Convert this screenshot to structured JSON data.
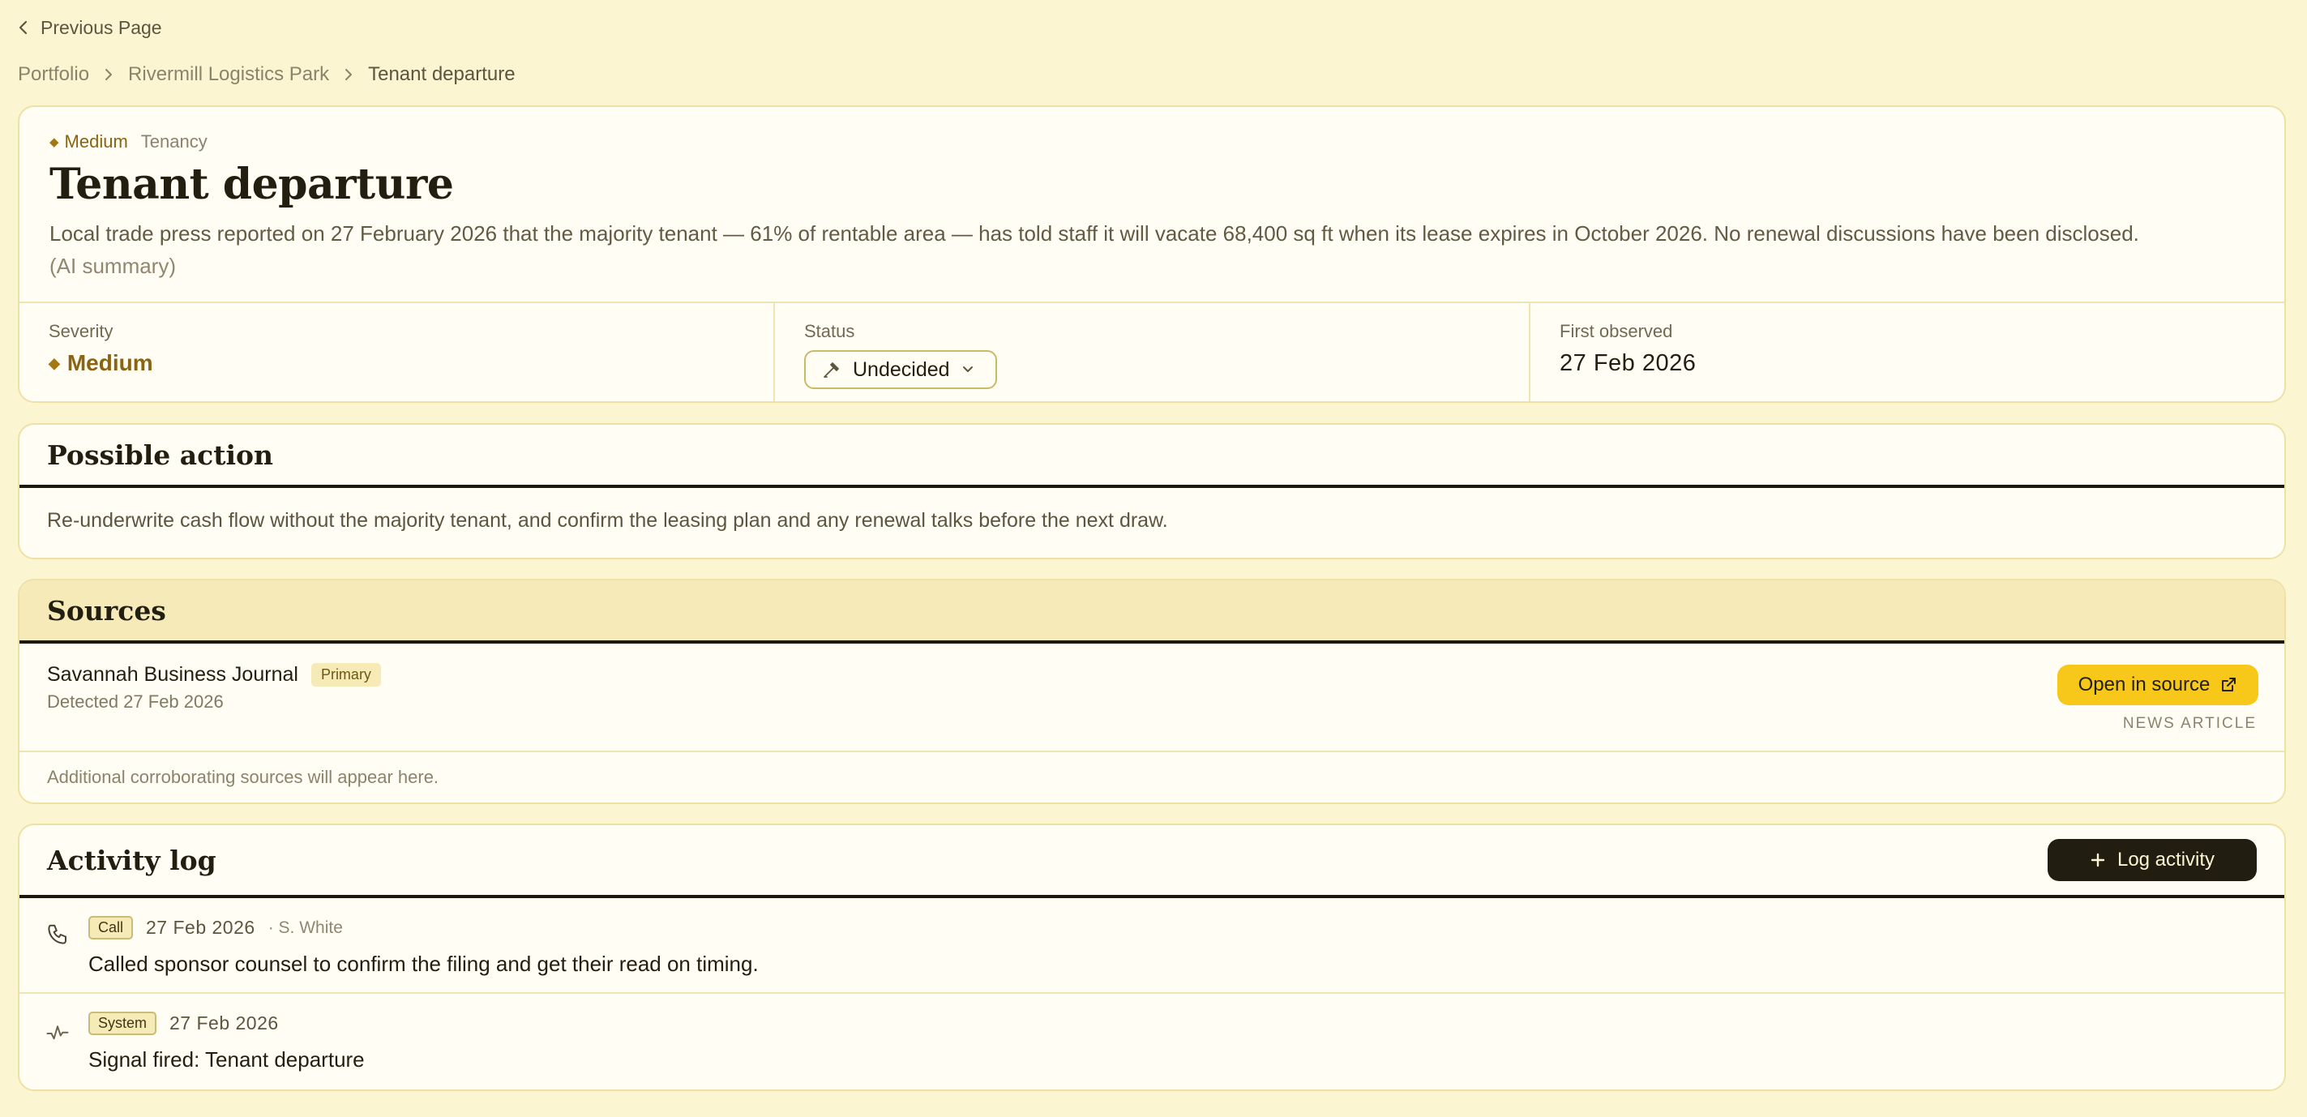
{
  "nav": {
    "back_label": "Previous Page"
  },
  "breadcrumb": [
    {
      "label": "Portfolio"
    },
    {
      "label": "Rivermill Logistics Park"
    },
    {
      "label": "Tenant departure"
    }
  ],
  "signal": {
    "severity_tag": "Medium",
    "category": "Tenancy",
    "title": "Tenant departure",
    "summary": "Local trade press reported on 27 February 2026 that the majority tenant — 61% of rentable area — has told staff it will vacate 68,400 sq ft when its lease expires in October 2026. No renewal discussions have been disclosed.",
    "ai_note": "(AI summary)",
    "stats": {
      "severity_label": "Severity",
      "severity_value": "Medium",
      "status_label": "Status",
      "status_value": "Undecided",
      "first_observed_label": "First observed",
      "first_observed_value": "27 Feb 2026"
    }
  },
  "possible_action": {
    "heading": "Possible action",
    "text": "Re-underwrite cash flow without the majority tenant, and confirm the leasing plan and any renewal talks before the next draw."
  },
  "sources": {
    "heading": "Sources",
    "items": [
      {
        "name": "Savannah Business Journal",
        "badge": "Primary",
        "detected": "Detected 27 Feb 2026",
        "open_label": "Open in source",
        "kind": "NEWS ARTICLE"
      }
    ],
    "note": "Additional corroborating sources will appear here."
  },
  "activity": {
    "heading": "Activity log",
    "log_button": "Log activity",
    "items": [
      {
        "icon": "phone-icon",
        "type": "Call",
        "date": "27 Feb 2026",
        "author": "· S. White",
        "text": "Called sponsor counsel to confirm the filing and get their read on timing."
      },
      {
        "icon": "pulse-icon",
        "type": "System",
        "date": "27 Feb 2026",
        "author": "",
        "text": "Signal fired: Tenant departure"
      }
    ]
  },
  "colors": {
    "page_bg": "#fcf5d2",
    "card_bg": "#fffdf4",
    "accent_yellow": "#f7c81a",
    "severity_medium": "#8a6410",
    "dark_button": "#211d10"
  }
}
